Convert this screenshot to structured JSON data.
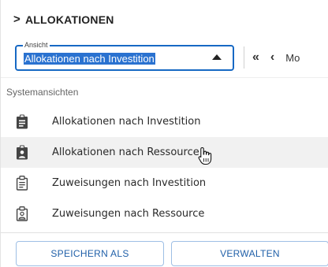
{
  "panel": {
    "title": "ALLOKATIONEN",
    "chevron": ">"
  },
  "view_select": {
    "legend": "Ansicht",
    "value": "Allokationen nach Investition",
    "accent_color": "#1769c4"
  },
  "toolbar": {
    "first_glyph": "«",
    "prev_glyph": "‹",
    "overflow_text": "Mo"
  },
  "menu": {
    "section_label": "Systemansichten",
    "items": [
      {
        "label": "Allokationen nach Investition",
        "icon": "clipboard-filled-icon",
        "hovered": false
      },
      {
        "label": "Allokationen nach Ressource",
        "icon": "clipboard-person-filled-icon",
        "hovered": true
      },
      {
        "label": "Zuweisungen nach Investition",
        "icon": "clipboard-outline-icon",
        "hovered": false
      },
      {
        "label": "Zuweisungen nach Ressource",
        "icon": "clipboard-person-outline-icon",
        "hovered": false
      }
    ]
  },
  "footer": {
    "save_as_label": "SPEICHERN ALS",
    "manage_label": "VERWALTEN",
    "button_color": "#1f5fa8"
  }
}
